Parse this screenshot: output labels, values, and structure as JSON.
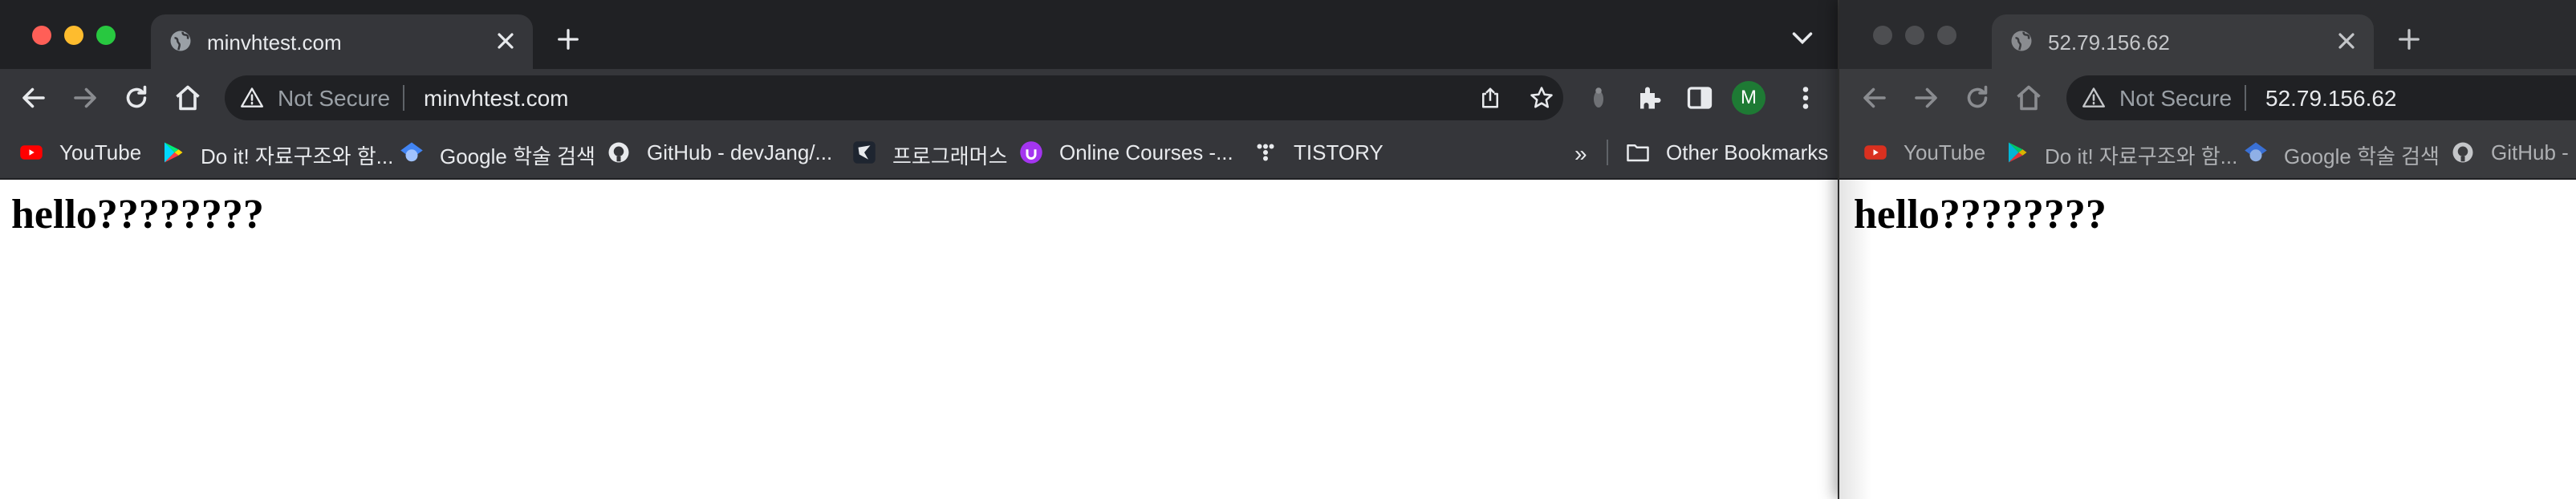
{
  "windows": [
    {
      "tab": {
        "title": "minvhtest.com"
      },
      "omnibox": {
        "security": "Not Secure",
        "url": "minvhtest.com"
      },
      "profile_initial": "M",
      "bookmarks": [
        {
          "label": "YouTube",
          "icon": "youtube-icon"
        },
        {
          "label": "Do it! 자료구조와 함...",
          "icon": "play-store-icon"
        },
        {
          "label": "Google 학술 검색",
          "icon": "scholar-icon"
        },
        {
          "label": "GitHub - devJang/...",
          "icon": "github-icon"
        },
        {
          "label": "프로그래머스",
          "icon": "programmers-icon"
        },
        {
          "label": "Online Courses -...",
          "icon": "udemy-icon"
        },
        {
          "label": "TISTORY",
          "icon": "tistory-icon"
        }
      ],
      "bookmarks_overflow": "»",
      "other_bookmarks": "Other Bookmarks",
      "page": {
        "heading": "hello????????"
      }
    },
    {
      "tab": {
        "title": "52.79.156.62"
      },
      "omnibox": {
        "security": "Not Secure",
        "url": "52.79.156.62"
      },
      "bookmarks": [
        {
          "label": "YouTube",
          "icon": "youtube-icon"
        },
        {
          "label": "Do it! 자료구조와 함...",
          "icon": "play-store-icon"
        },
        {
          "label": "Google 학술 검색",
          "icon": "scholar-icon"
        },
        {
          "label": "GitHub -",
          "icon": "github-icon"
        }
      ],
      "page": {
        "heading": "hello????????"
      }
    }
  ],
  "colors": {
    "tabstrip": "#202124",
    "toolbar": "#35363a",
    "close_dot": "#ff5f57",
    "minimize_dot": "#febc2e",
    "zoom_dot": "#28c840",
    "profile": "#1e7a34"
  }
}
